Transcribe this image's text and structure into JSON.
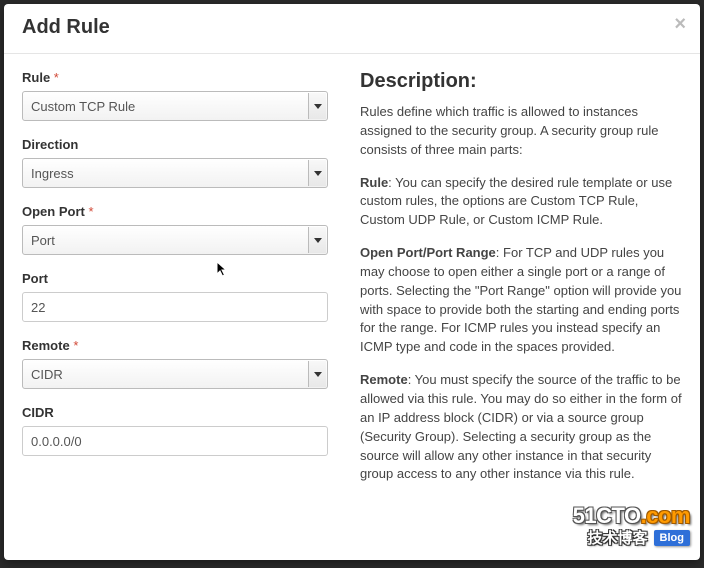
{
  "modal": {
    "title": "Add Rule",
    "close": "×"
  },
  "form": {
    "rule": {
      "label": "Rule",
      "required": "*",
      "value": "Custom TCP Rule"
    },
    "direction": {
      "label": "Direction",
      "value": "Ingress"
    },
    "openPort": {
      "label": "Open Port",
      "required": "*",
      "value": "Port"
    },
    "port": {
      "label": "Port",
      "value": "22"
    },
    "remote": {
      "label": "Remote",
      "required": "*",
      "value": "CIDR"
    },
    "cidr": {
      "label": "CIDR",
      "value": "0.0.0.0/0"
    }
  },
  "description": {
    "title": "Description:",
    "intro": "Rules define which traffic is allowed to instances assigned to the security group. A security group rule consists of three main parts:",
    "rule_label": "Rule",
    "rule_text": ": You can specify the desired rule template or use custom rules, the options are Custom TCP Rule, Custom UDP Rule, or Custom ICMP Rule.",
    "openport_label": "Open Port/Port Range",
    "openport_text": ": For TCP and UDP rules you may choose to open either a single port or a range of ports. Selecting the \"Port Range\" option will provide you with space to provide both the starting and ending ports for the range. For ICMP rules you instead specify an ICMP type and code in the spaces provided.",
    "remote_label": "Remote",
    "remote_text": ": You must specify the source of the traffic to be allowed via this rule. You may do so either in the form of an IP address block (CIDR) or via a source group (Security Group). Selecting a security group as the source will allow any other instance in that security group access to any other instance via this rule."
  },
  "watermark": {
    "site_prefix": "51CTO",
    "site_suffix": ".com",
    "cn": "技术博客",
    "blog": "Blog"
  }
}
